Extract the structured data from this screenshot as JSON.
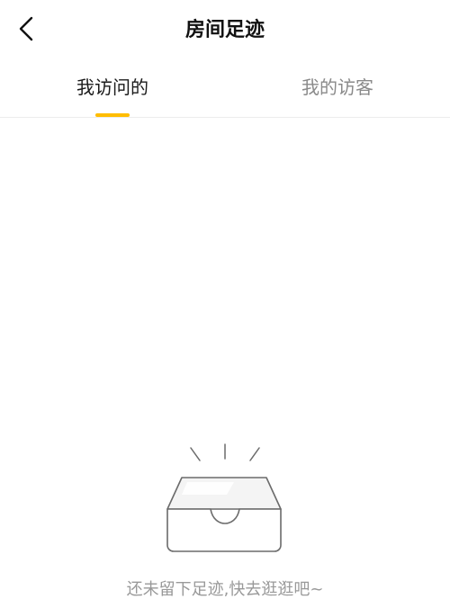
{
  "header": {
    "title": "房间足迹",
    "back_icon": "chevron-left-icon"
  },
  "tabs": [
    {
      "label": "我访问的",
      "active": true
    },
    {
      "label": "我的访客",
      "active": false
    }
  ],
  "colors": {
    "accent": "#ffbd00",
    "text_primary": "#111111",
    "text_inactive": "#8a8a8a",
    "text_muted": "#999999",
    "divider": "#ececec"
  },
  "empty_state": {
    "icon": "empty-box-icon",
    "message": "还未留下足迹,快去逛逛吧~"
  }
}
